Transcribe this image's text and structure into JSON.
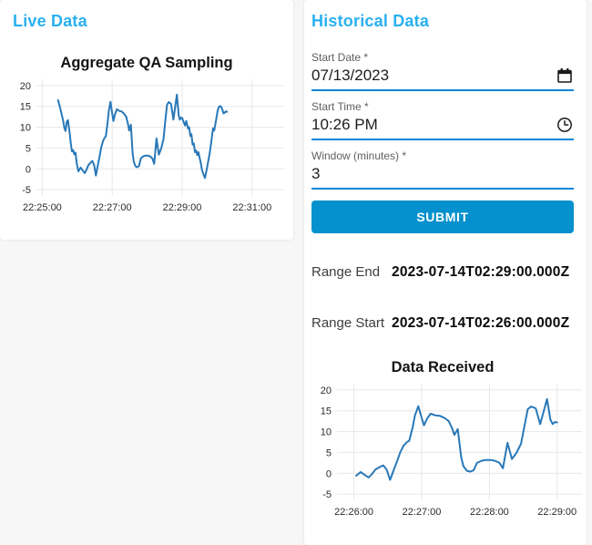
{
  "page": {
    "background": "#f7f7f7",
    "card_background": "#ffffff",
    "heading_color": "#29b0f0",
    "underline_color": "#0f86d9",
    "submit_color": "#0591cd",
    "chart_line_color": "#2878b8"
  },
  "live_panel": {
    "heading": "Live Data"
  },
  "historical_panel": {
    "heading": "Historical Data",
    "fields": [
      {
        "label": "Start Date *",
        "value": "07/13/2023",
        "icon": "calendar-icon"
      },
      {
        "label": "Start Time *",
        "value": "10:26 PM",
        "icon": "clock-icon"
      },
      {
        "label": "Window (minutes) *",
        "value": "3",
        "icon": ""
      }
    ],
    "submit_label": "SUBMIT",
    "results": [
      {
        "label": "Range End",
        "value": "2023-07-14T02:29:00.000Z"
      },
      {
        "label": "Range Start",
        "value": "2023-07-14T02:26:00.000Z"
      }
    ]
  },
  "chart_data": [
    {
      "type": "line",
      "title": "Aggregate QA Sampling",
      "xlabel": "",
      "ylabel": "",
      "x_unit": "seconds after 22:25:00",
      "xlim": [
        -10,
        415
      ],
      "ylim": [
        -6.5,
        21.5
      ],
      "x_ticks": [
        {
          "value": 0,
          "label": "22:25:00"
        },
        {
          "value": 120,
          "label": "22:27:00"
        },
        {
          "value": 240,
          "label": "22:29:00"
        },
        {
          "value": 360,
          "label": "22:31:00"
        }
      ],
      "y_ticks": [
        -5,
        0,
        5,
        10,
        15,
        20
      ],
      "grid": true,
      "legend": false,
      "line_color": "#2878b8",
      "series": [
        {
          "name": "Aggregate QA Sampling",
          "points": [
            [
              27,
              16.5
            ],
            [
              30,
              15.0
            ],
            [
              33,
              13.3
            ],
            [
              36,
              11.5
            ],
            [
              38,
              9.8
            ],
            [
              40,
              9.1
            ],
            [
              42,
              11.3
            ],
            [
              44,
              11.7
            ],
            [
              47,
              8.6
            ],
            [
              49,
              6.0
            ],
            [
              51,
              4.2
            ],
            [
              53,
              4.5
            ],
            [
              55,
              3.5
            ],
            [
              57,
              3.9
            ],
            [
              59,
              1.4
            ],
            [
              62,
              -0.6
            ],
            [
              66,
              0.3
            ],
            [
              69,
              -0.3
            ],
            [
              73,
              -1.0
            ],
            [
              76,
              -0.2
            ],
            [
              79,
              0.9
            ],
            [
              83,
              1.5
            ],
            [
              86,
              1.9
            ],
            [
              89,
              0.9
            ],
            [
              92,
              -1.6
            ],
            [
              95,
              0.6
            ],
            [
              98,
              2.7
            ],
            [
              101,
              5.0
            ],
            [
              104,
              6.6
            ],
            [
              107,
              7.5
            ],
            [
              109,
              7.8
            ],
            [
              112,
              11.0
            ],
            [
              114,
              13.8
            ],
            [
              117,
              16.1
            ],
            [
              120,
              13.3
            ],
            [
              122,
              11.5
            ],
            [
              125,
              13.2
            ],
            [
              128,
              14.3
            ],
            [
              132,
              13.9
            ],
            [
              136,
              13.8
            ],
            [
              140,
              13.3
            ],
            [
              144,
              12.5
            ],
            [
              147,
              10.8
            ],
            [
              149,
              9.2
            ],
            [
              152,
              10.6
            ],
            [
              155,
              3.8
            ],
            [
              157,
              1.7
            ],
            [
              160,
              0.6
            ],
            [
              163,
              0.4
            ],
            [
              166,
              0.7
            ],
            [
              169,
              2.5
            ],
            [
              173,
              3.0
            ],
            [
              177,
              3.2
            ],
            [
              181,
              3.2
            ],
            [
              185,
              3.0
            ],
            [
              189,
              2.5
            ],
            [
              192,
              1.2
            ],
            [
              196,
              7.3
            ],
            [
              200,
              3.4
            ],
            [
              204,
              4.9
            ],
            [
              208,
              7.1
            ],
            [
              211,
              11.3
            ],
            [
              214,
              15.4
            ],
            [
              217,
              16.0
            ],
            [
              221,
              15.6
            ],
            [
              225,
              11.8
            ],
            [
              228,
              14.8
            ],
            [
              231,
              17.8
            ],
            [
              234,
              12.9
            ],
            [
              236,
              11.8
            ],
            [
              238,
              12.3
            ],
            [
              240,
              12.2
            ],
            [
              243,
              11.1
            ],
            [
              245,
              10.4
            ],
            [
              247,
              11.5
            ],
            [
              250,
              9.7
            ],
            [
              252,
              10.0
            ],
            [
              254,
              7.9
            ],
            [
              256,
              8.3
            ],
            [
              258,
              5.8
            ],
            [
              260,
              6.1
            ],
            [
              262,
              4.0
            ],
            [
              264,
              4.4
            ],
            [
              266,
              3.3
            ],
            [
              268,
              4.0
            ],
            [
              270,
              2.6
            ],
            [
              272,
              1.4
            ],
            [
              274,
              -0.3
            ],
            [
              277,
              -1.5
            ],
            [
              279,
              -2.2
            ],
            [
              281,
              -1.0
            ],
            [
              283,
              0.5
            ],
            [
              285,
              2.0
            ],
            [
              287,
              3.6
            ],
            [
              289,
              5.5
            ],
            [
              291,
              7.5
            ],
            [
              293,
              9.7
            ],
            [
              295,
              9.2
            ],
            [
              297,
              10.8
            ],
            [
              299,
              12.4
            ],
            [
              301,
              14.0
            ],
            [
              303,
              14.8
            ],
            [
              305,
              15.1
            ],
            [
              307,
              14.9
            ],
            [
              309,
              14.2
            ],
            [
              311,
              13.3
            ],
            [
              313,
              13.5
            ],
            [
              315,
              13.8
            ],
            [
              317,
              13.7
            ]
          ]
        }
      ]
    },
    {
      "type": "line",
      "title": "Data Received",
      "xlabel": "",
      "ylabel": "",
      "x_unit": "seconds after 22:26:00",
      "xlim": [
        -15,
        202
      ],
      "ylim": [
        -6.5,
        21.5
      ],
      "x_ticks": [
        {
          "value": 0,
          "label": "22:26:00"
        },
        {
          "value": 60,
          "label": "22:27:00"
        },
        {
          "value": 120,
          "label": "22:28:00"
        },
        {
          "value": 180,
          "label": "22:29:00"
        }
      ],
      "y_ticks": [
        -5,
        0,
        5,
        10,
        15,
        20
      ],
      "grid": true,
      "legend": false,
      "line_color": "#2878b8",
      "series": [
        {
          "name": "Data Received",
          "points": [
            [
              2,
              -0.6
            ],
            [
              6,
              0.3
            ],
            [
              9,
              -0.3
            ],
            [
              13,
              -1.0
            ],
            [
              16,
              -0.2
            ],
            [
              19,
              0.9
            ],
            [
              23,
              1.5
            ],
            [
              26,
              1.9
            ],
            [
              29,
              0.9
            ],
            [
              32,
              -1.6
            ],
            [
              35,
              0.6
            ],
            [
              38,
              2.7
            ],
            [
              41,
              5.0
            ],
            [
              44,
              6.6
            ],
            [
              47,
              7.5
            ],
            [
              49,
              7.8
            ],
            [
              52,
              11.0
            ],
            [
              54,
              13.8
            ],
            [
              57,
              16.1
            ],
            [
              60,
              13.3
            ],
            [
              62,
              11.5
            ],
            [
              65,
              13.2
            ],
            [
              68,
              14.3
            ],
            [
              72,
              13.9
            ],
            [
              76,
              13.8
            ],
            [
              80,
              13.3
            ],
            [
              84,
              12.5
            ],
            [
              87,
              10.8
            ],
            [
              89,
              9.2
            ],
            [
              92,
              10.6
            ],
            [
              95,
              3.8
            ],
            [
              97,
              1.7
            ],
            [
              100,
              0.6
            ],
            [
              103,
              0.4
            ],
            [
              106,
              0.7
            ],
            [
              109,
              2.5
            ],
            [
              113,
              3.0
            ],
            [
              117,
              3.2
            ],
            [
              121,
              3.2
            ],
            [
              125,
              3.0
            ],
            [
              129,
              2.5
            ],
            [
              132,
              1.2
            ],
            [
              136,
              7.3
            ],
            [
              140,
              3.4
            ],
            [
              144,
              4.9
            ],
            [
              148,
              7.1
            ],
            [
              151,
              11.3
            ],
            [
              154,
              15.4
            ],
            [
              157,
              16.0
            ],
            [
              161,
              15.6
            ],
            [
              165,
              11.8
            ],
            [
              168,
              14.8
            ],
            [
              171,
              17.8
            ],
            [
              174,
              12.9
            ],
            [
              176,
              11.8
            ],
            [
              178,
              12.3
            ],
            [
              180,
              12.2
            ]
          ]
        }
      ]
    }
  ]
}
